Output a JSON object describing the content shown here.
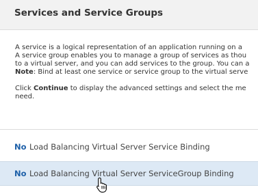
{
  "panel": {
    "title": "Services and Service Groups"
  },
  "description": {
    "line1": "A service is a logical representation of an application running on a",
    "line2": "A service group enables you to manage a group of services as thou",
    "line3": "to a virtual server, and you can add services to the group. You can a",
    "note_label": "Note",
    "note_text": ": Bind at least one service or service group to the virtual serve",
    "click_prefix": "Click ",
    "continue_label": "Continue",
    "click_suffix": " to display the advanced settings and select the me",
    "line_need": "need."
  },
  "bindings": [
    {
      "count": "No",
      "label": "Load Balancing Virtual Server Service Binding"
    },
    {
      "count": "No",
      "label": "Load Balancing Virtual Server ServiceGroup Binding"
    }
  ],
  "colors": {
    "link": "#1c5fa8",
    "header_bg": "#f2f2f2",
    "hover_bg": "#dde9f5"
  },
  "cursor": "hand-pointer-icon"
}
